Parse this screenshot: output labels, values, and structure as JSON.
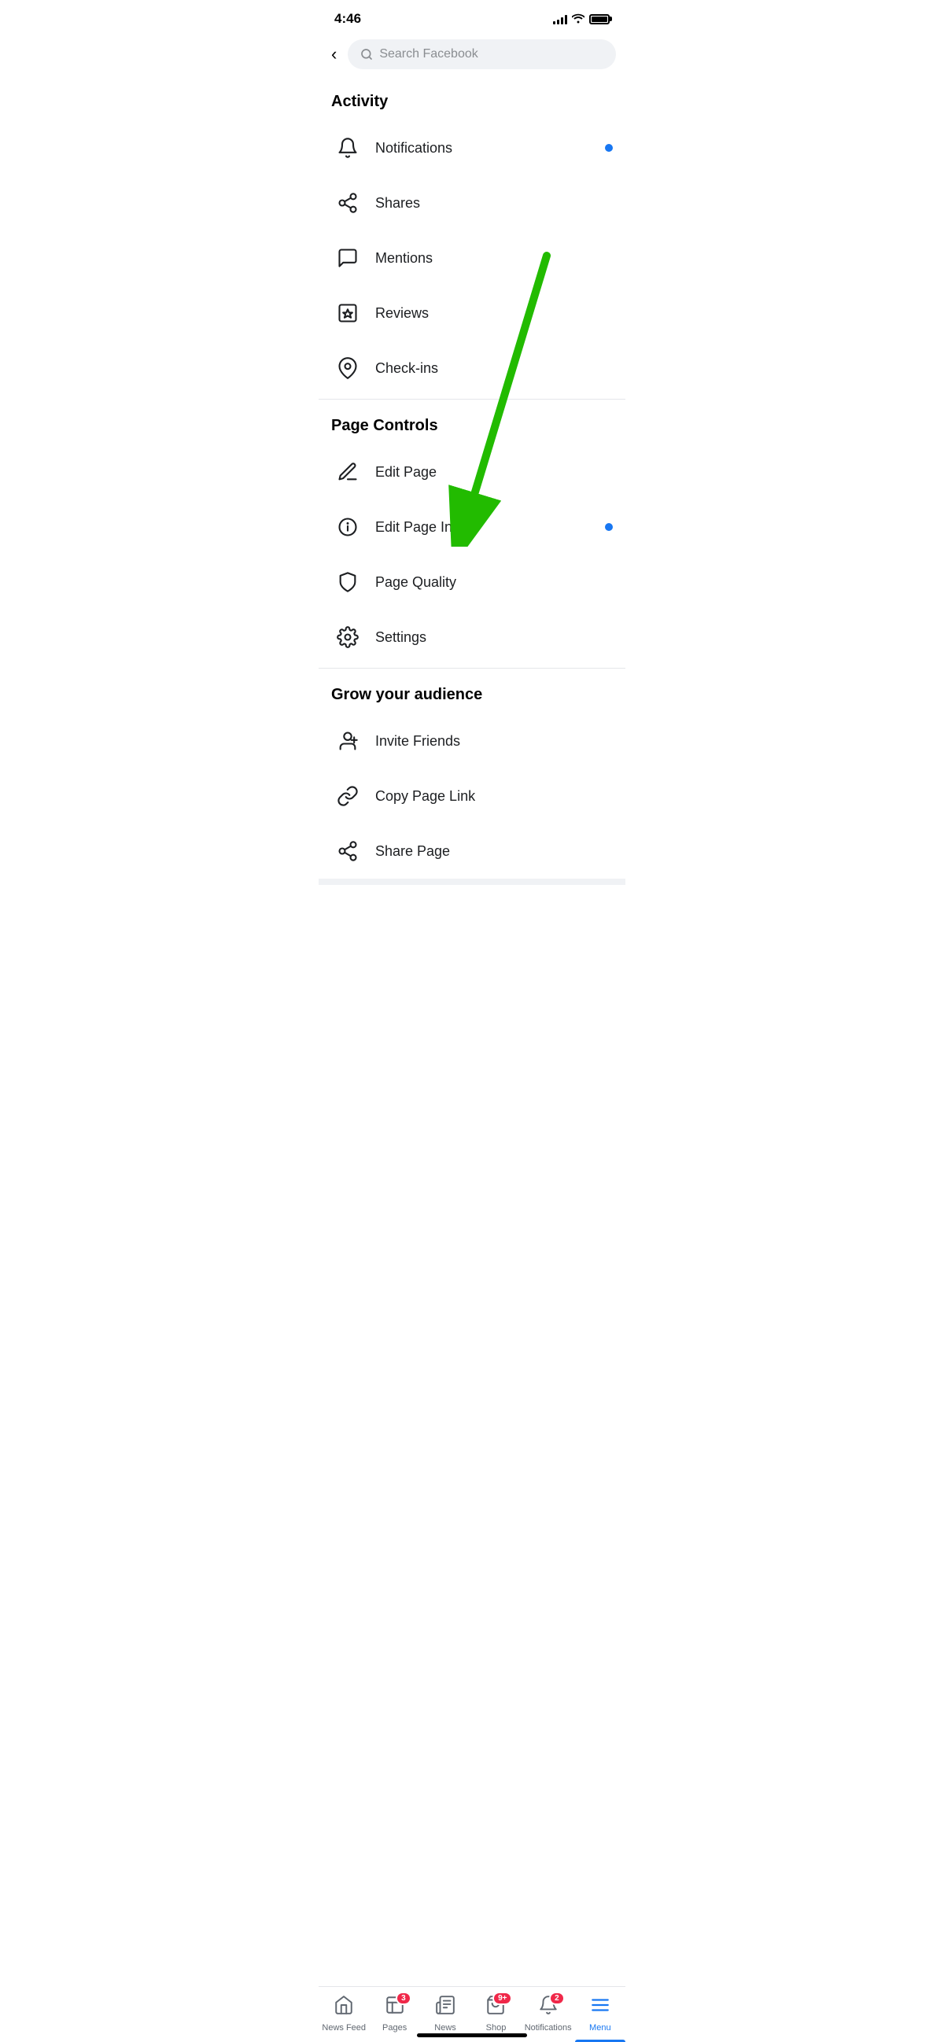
{
  "statusBar": {
    "time": "4:46"
  },
  "searchBar": {
    "backLabel": "‹",
    "placeholder": "Search Facebook"
  },
  "sections": {
    "activity": {
      "title": "Activity",
      "items": [
        {
          "id": "notifications",
          "label": "Notifications",
          "hasDot": true
        },
        {
          "id": "shares",
          "label": "Shares",
          "hasDot": false
        },
        {
          "id": "mentions",
          "label": "Mentions",
          "hasDot": false
        },
        {
          "id": "reviews",
          "label": "Reviews",
          "hasDot": false
        },
        {
          "id": "checkins",
          "label": "Check-ins",
          "hasDot": false
        }
      ]
    },
    "pageControls": {
      "title": "Page Controls",
      "items": [
        {
          "id": "edit-page",
          "label": "Edit Page",
          "hasDot": false
        },
        {
          "id": "edit-page-info",
          "label": "Edit Page Info",
          "hasDot": true
        },
        {
          "id": "page-quality",
          "label": "Page Quality",
          "hasDot": false
        },
        {
          "id": "settings",
          "label": "Settings",
          "hasDot": false
        }
      ]
    },
    "growAudience": {
      "title": "Grow your audience",
      "items": [
        {
          "id": "invite-friends",
          "label": "Invite Friends",
          "hasDot": false
        },
        {
          "id": "copy-page-link",
          "label": "Copy Page Link",
          "hasDot": false
        },
        {
          "id": "share-page",
          "label": "Share Page",
          "hasDot": false
        }
      ]
    }
  },
  "tabBar": {
    "items": [
      {
        "id": "news-feed",
        "label": "News Feed",
        "badge": null,
        "active": false
      },
      {
        "id": "pages",
        "label": "Pages",
        "badge": "3",
        "active": false
      },
      {
        "id": "news",
        "label": "News",
        "badge": null,
        "active": false
      },
      {
        "id": "shop",
        "label": "Shop",
        "badge": "9+",
        "active": false
      },
      {
        "id": "notifications",
        "label": "Notifications",
        "badge": "2",
        "active": false
      },
      {
        "id": "menu",
        "label": "Menu",
        "badge": null,
        "active": true
      }
    ]
  }
}
